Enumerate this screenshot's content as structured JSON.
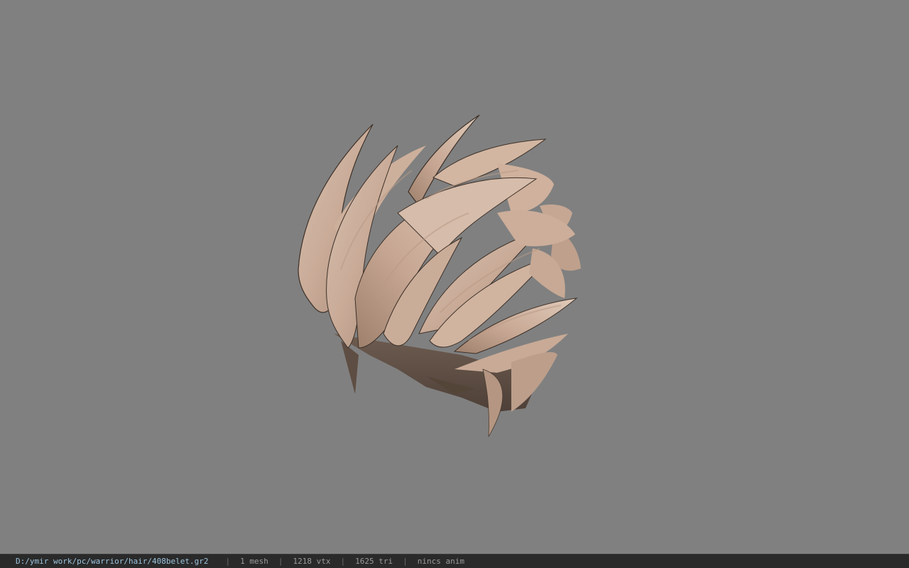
{
  "status": {
    "file_path": "D:/ymir work/pc/warrior/hair/408belet.gr2",
    "separator": "|",
    "mesh_count": "1 mesh",
    "vertex_count": "1218 vtx",
    "triangle_count": "1625 tri",
    "anim_status": "nincs anim"
  },
  "colors": {
    "viewport_background": "#808080",
    "statusbar_background": "#2a2a2a",
    "path_text": "#9cc4de",
    "hair_base": "#c9ab98",
    "hair_shadow": "#5a4a40"
  },
  "model": {
    "icon": "hair-mesh-3d"
  }
}
